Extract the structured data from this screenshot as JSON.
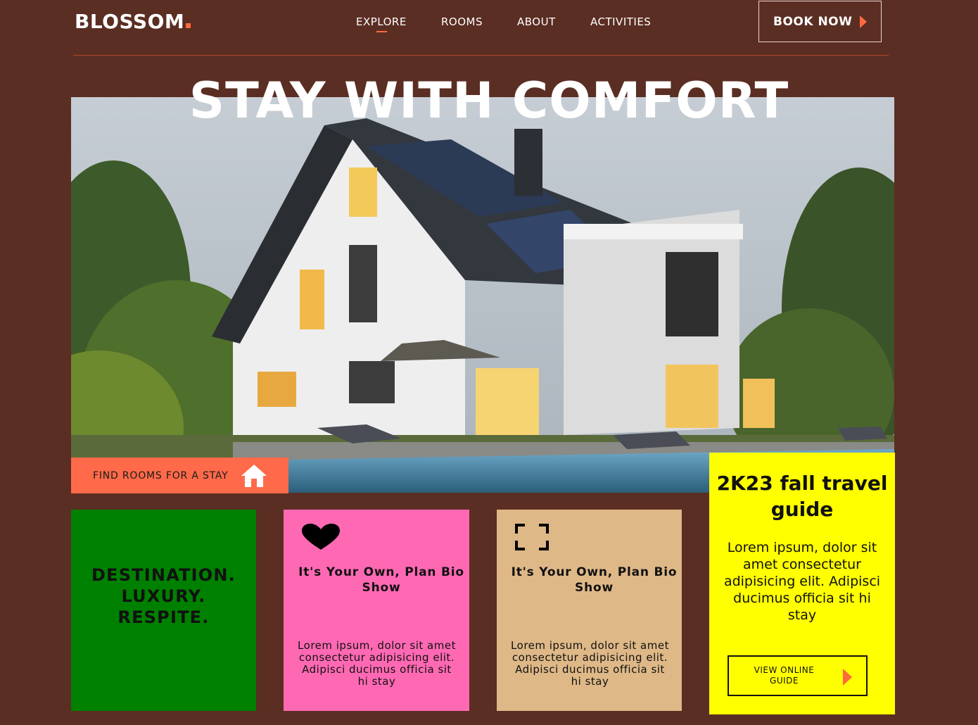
{
  "brand": {
    "name": "BLOSSOM",
    "accent": "#ff6a3d"
  },
  "nav": {
    "items": [
      {
        "label": "EXPLORE",
        "active": true
      },
      {
        "label": "ROOMS"
      },
      {
        "label": "ABOUT"
      },
      {
        "label": "ACTIVITIES"
      }
    ],
    "book_label": "BOOK NOW"
  },
  "hero": {
    "title": "STAY WITH COMFORT",
    "image": "modern-house-with-pool",
    "cta_label": "FIND ROOMS FOR A STAY",
    "cta_icon": "home-icon"
  },
  "cards": [
    {
      "text": "DESTINATION.\nLUXURY.\nRESPITE.",
      "color": "#008000"
    },
    {
      "icon": "heart-icon",
      "title": "It's Your Own, Plan Bio Show",
      "body": "Lorem ipsum, dolor sit amet consectetur adipisicing elit. Adipisci ducimus officia sit hi stay",
      "color": "#ff69b4"
    },
    {
      "icon": "fullscreen-icon",
      "title": "It's Your Own, Plan Bio Show",
      "body": "Lorem ipsum, dolor sit amet consectetur adipisicing elit. Adipisci ducimus officia sit hi stay",
      "color": "#deb887"
    }
  ],
  "guide": {
    "title": "2K23 fall travel guide",
    "body": "Lorem ipsum, dolor sit amet consectetur adipisicing elit. Adipisci ducimus officia sit hi stay",
    "button_label": "VIEW ONLINE GUIDE",
    "color": "#ffff00"
  }
}
